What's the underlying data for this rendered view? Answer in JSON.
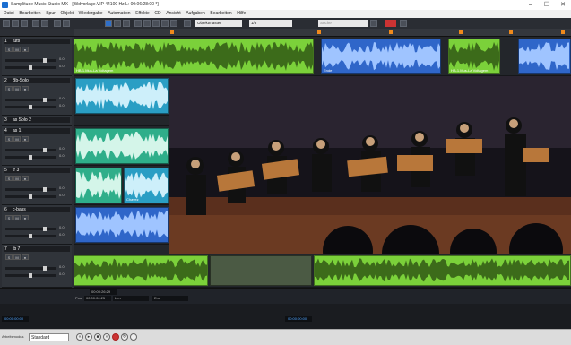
{
  "window": {
    "title": "Samplitude Music Studio MX - [Bildvorlage.VIP   44100 Hz L: 00:06:28:00 *]",
    "minimize": "–",
    "maximize": "☐",
    "close": "✕"
  },
  "menu": [
    "Datei",
    "Bearbeiten",
    "Spur",
    "Objekt",
    "Wiedergabe",
    "Automation",
    "Effekte",
    "CD",
    "Ansicht",
    "Aufgaben",
    "Bearbeiten",
    "Hilfe"
  ],
  "toolbar": {
    "zoom_mode": "Objektmaster",
    "zoom_value": "1/8",
    "search_placeholder": "Suche"
  },
  "tracks": [
    {
      "num": "1",
      "name": "tutti",
      "vol": "0.0",
      "pan": "0.0"
    },
    {
      "num": "2",
      "name": "Bb-Solo",
      "vol": "0.0",
      "pan": "0.0"
    },
    {
      "num": "3",
      "name": "as Solo 2",
      "vol": "0.0",
      "pan": "0.0"
    },
    {
      "num": "4",
      "name": "as 1",
      "vol": "0.0",
      "pan": "0.0"
    },
    {
      "num": "5",
      "name": "tr 3",
      "vol": "0.0",
      "pan": "0.0"
    },
    {
      "num": "6",
      "name": "c-bass",
      "vol": "0.0",
      "pan": "0.0"
    },
    {
      "num": "7",
      "name": "tb 7",
      "vol": "0.0",
      "pan": "0.0"
    }
  ],
  "clips": {
    "lane1": [
      "HB-1.Mus-La Voltagem",
      "Ende",
      "HB-1.Mus-La Voltagem"
    ],
    "lane5": [
      "Chavez"
    ]
  },
  "status": {
    "time": "00:00:26:29",
    "pos_label": "Pos",
    "pos_value": "00:00:00:25",
    "len_label": "Len",
    "end_label": "End"
  },
  "bottom": {
    "left_time": "00:00:00:00",
    "right_time": "00:00:00:00"
  },
  "transport": {
    "mode_label": "Arbeitsmodus",
    "preset": "Standard"
  },
  "colors": {
    "green": "#7bd13a",
    "blue": "#2f66c9",
    "cyan": "#2a9ec4",
    "teal": "#2fae8a",
    "orange": "#f08a1c"
  },
  "icons": [
    "select-icon",
    "cut-icon",
    "zoom-icon",
    "record-icon",
    "play-icon",
    "stop-icon",
    "loop-icon"
  ]
}
